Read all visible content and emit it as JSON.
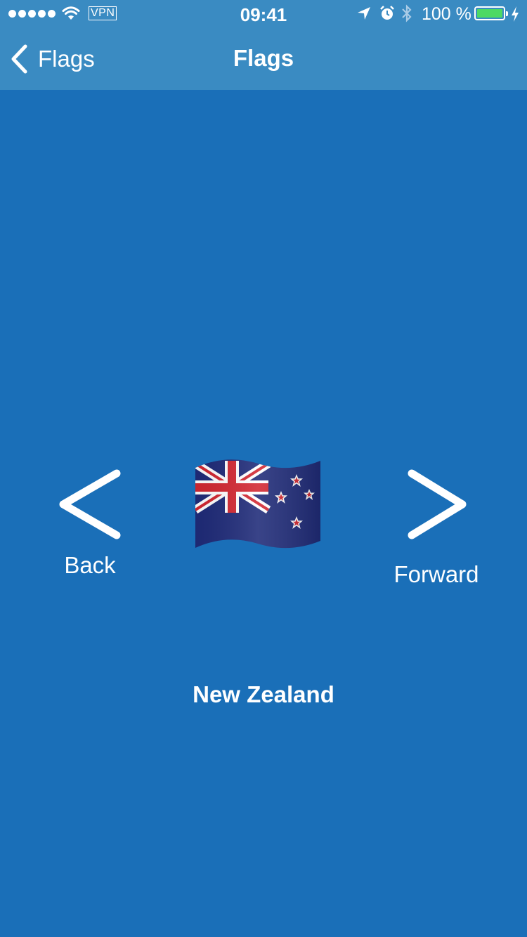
{
  "status_bar": {
    "vpn": "VPN",
    "time": "09:41",
    "battery_percent": "100 %",
    "battery_level": 1.0,
    "battery_color": "#4cd964"
  },
  "nav": {
    "back_label": "Flags",
    "title": "Flags"
  },
  "content": {
    "back_label": "Back",
    "forward_label": "Forward",
    "country_name": "New Zealand",
    "flag_icon": "new-zealand-flag"
  },
  "colors": {
    "background": "#1a6fb8",
    "nav_background": "#3a8bc2"
  }
}
